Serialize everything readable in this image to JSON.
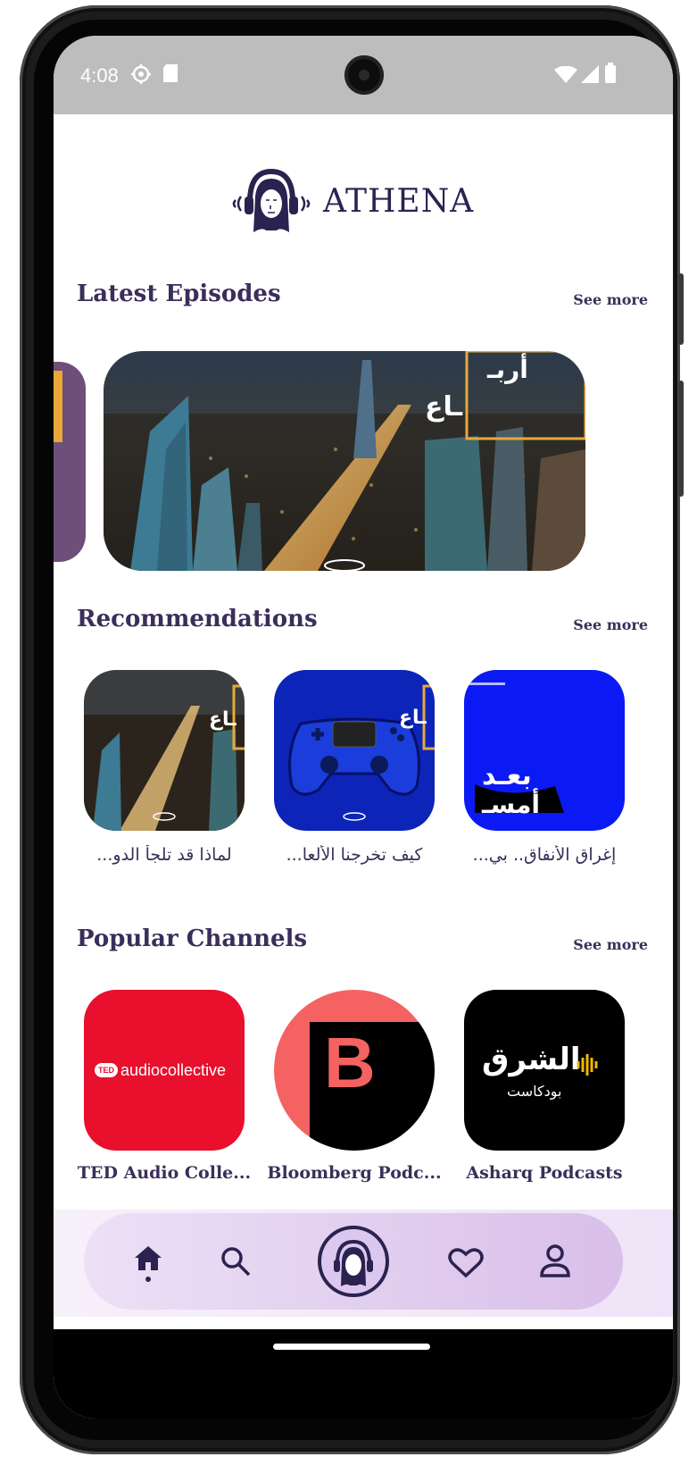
{
  "status_bar": {
    "time": "4:08"
  },
  "brand": {
    "name": "ATHENA"
  },
  "sections": {
    "latest": {
      "title": "Latest Episodes",
      "see_more": "See more"
    },
    "recommendations": {
      "title": "Recommendations",
      "see_more": "See more"
    },
    "channels": {
      "title": "Popular Channels",
      "see_more": "See more"
    }
  },
  "latest_episode": {
    "overlay_text_1": "أربـ",
    "overlay_text_2": "ـاع"
  },
  "recommendations": [
    {
      "title": "...لماذا قد تلجأ الدو",
      "overlay": "ـاع"
    },
    {
      "title": "...كيف تخرجنا الألعا",
      "overlay": "ـاع"
    },
    {
      "title": "...إغراق الأنفاق.. بي",
      "overlay_1": "بعـد",
      "overlay_2": "أمسـ"
    }
  ],
  "channels": [
    {
      "title": "TED Audio Colle...",
      "logo_text": "audiocollective",
      "badge": "TED"
    },
    {
      "title": "Bloomberg Podc...",
      "logo_text": "B"
    },
    {
      "title": "Asharq Podcasts",
      "logo_text": "الشرق",
      "logo_sub": "بودكاست"
    }
  ],
  "colors": {
    "primary": "#3a2e5a",
    "nav_start": "#ece0f6",
    "nav_end": "#d9bfe9",
    "ted_red": "#e8102d",
    "bloomberg_coral": "#f46262",
    "blue_card": "#0b1af5"
  },
  "icons": [
    "home-icon",
    "search-icon",
    "athena-logo-icon",
    "heart-icon",
    "profile-icon",
    "settings-icon",
    "sd-card-icon",
    "wifi-icon",
    "signal-icon",
    "battery-icon"
  ]
}
